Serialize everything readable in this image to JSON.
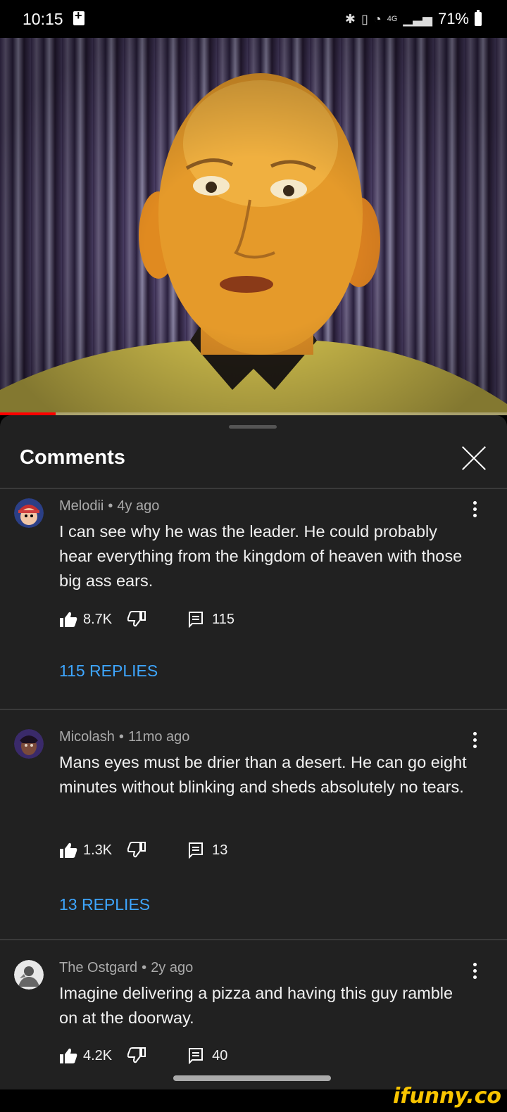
{
  "status_bar": {
    "time": "10:15",
    "network": "4G",
    "battery": "71%"
  },
  "video": {
    "progress_fraction": 0.11,
    "accent": "#ff0000"
  },
  "panel": {
    "title": "Comments"
  },
  "comments": [
    {
      "author": "Melodii",
      "age": "4y ago",
      "text": "I can see why he was the leader. He could probably hear everything from the kingdom of heaven with those big ass ears.",
      "likes": "8.7K",
      "reply_count": "115",
      "replies_link": "115 REPLIES"
    },
    {
      "author": "Micolash",
      "age": "11mo ago",
      "text": "Mans eyes must be drier than a desert. He can go eight minutes without blinking and sheds absolutely no tears.",
      "likes": "1.3K",
      "reply_count": "13",
      "replies_link": "13 REPLIES"
    },
    {
      "author": "The Ostgard",
      "age": "2y ago",
      "text": "Imagine delivering a pizza and having this guy ramble on at the doorway.",
      "likes": "4.2K",
      "reply_count": "40"
    }
  ],
  "watermark": "ifunny.co"
}
